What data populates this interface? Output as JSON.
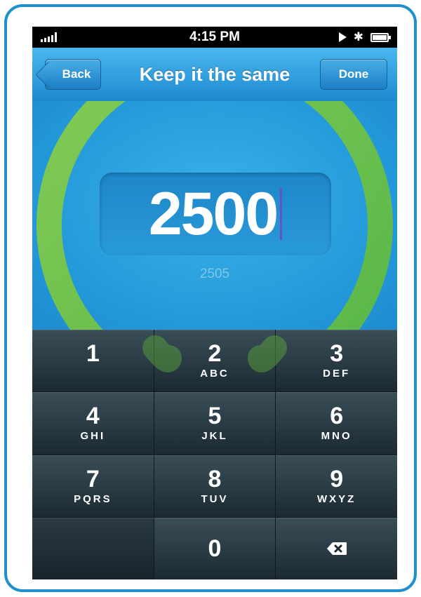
{
  "status_bar": {
    "time": "4:15 PM"
  },
  "nav": {
    "back_label": "Back",
    "title": "Keep it the same",
    "done_label": "Done"
  },
  "goal": {
    "value": "2500",
    "sub_value": "2505"
  },
  "keypad": {
    "keys": [
      {
        "digit": "1",
        "letters": ""
      },
      {
        "digit": "2",
        "letters": "ABC"
      },
      {
        "digit": "3",
        "letters": "DEF"
      },
      {
        "digit": "4",
        "letters": "GHI"
      },
      {
        "digit": "5",
        "letters": "JKL"
      },
      {
        "digit": "6",
        "letters": "MNO"
      },
      {
        "digit": "7",
        "letters": "PQRS"
      },
      {
        "digit": "8",
        "letters": "TUV"
      },
      {
        "digit": "9",
        "letters": "WXYZ"
      },
      {
        "digit": "0",
        "letters": ""
      }
    ],
    "delete_icon": "backspace-icon"
  },
  "colors": {
    "frame_border": "#1f8fcf",
    "nav_bar": "#2a9be0",
    "ring_green": "#6cc142",
    "keypad_bg": "#22323a"
  }
}
